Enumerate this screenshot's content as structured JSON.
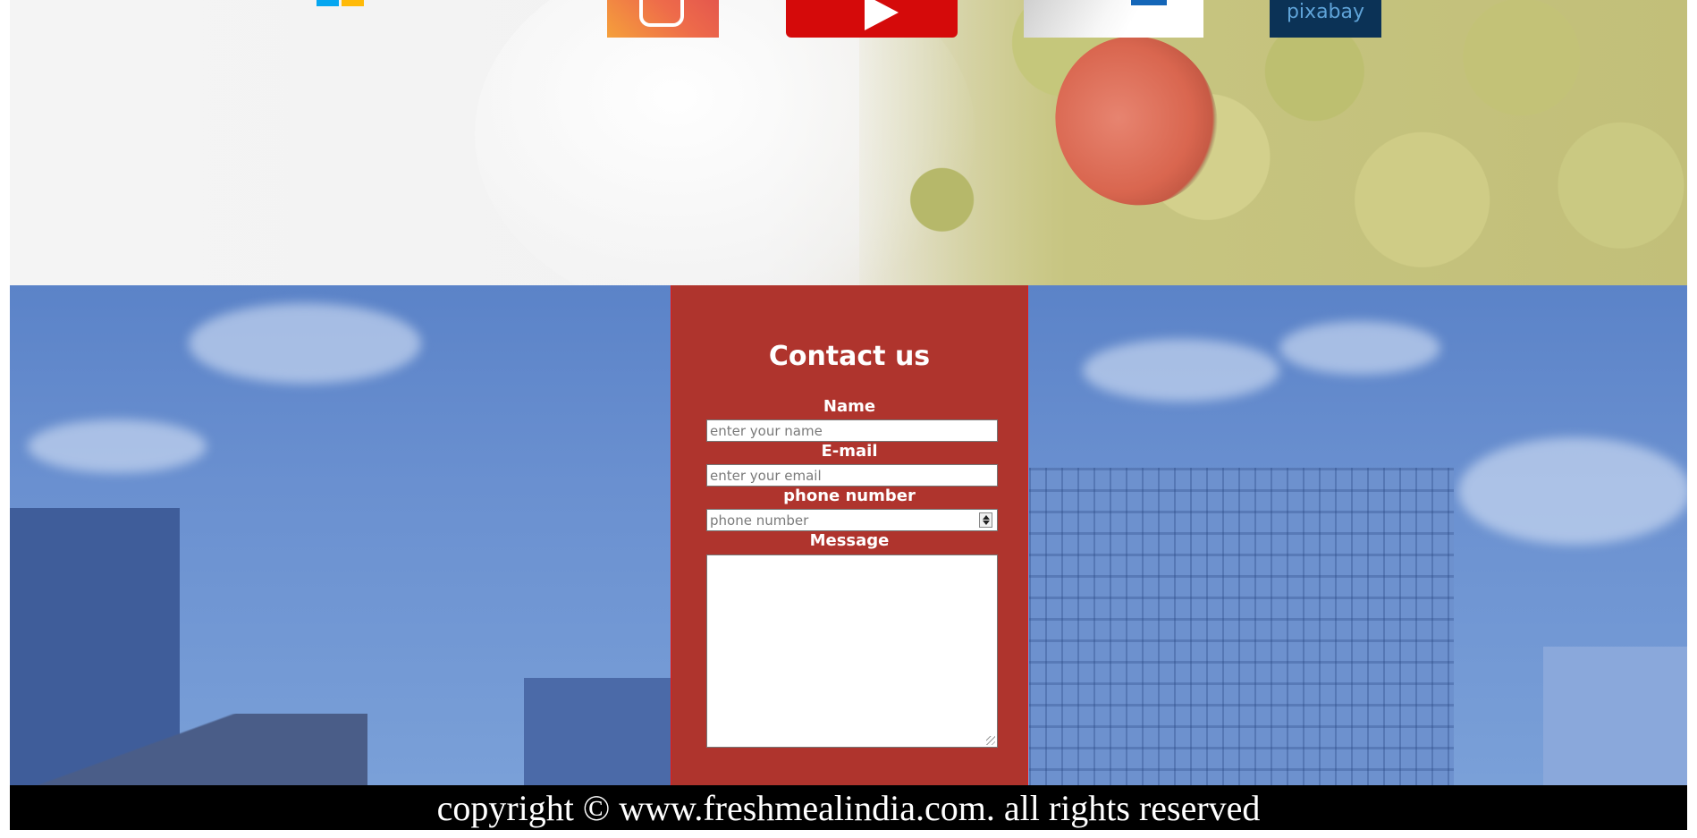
{
  "partner_logos": [
    {
      "name": "Microsoft"
    },
    {
      "name": "Instagram"
    },
    {
      "name": "YouTube"
    },
    {
      "name": "document"
    },
    {
      "name": "Pixabay",
      "label": "pixabay"
    }
  ],
  "contact": {
    "title": "Contact us",
    "fields": {
      "name": {
        "label": "Name",
        "placeholder": "enter your name",
        "value": ""
      },
      "email": {
        "label": "E-mail",
        "placeholder": "enter your email",
        "value": ""
      },
      "phone": {
        "label": "phone number",
        "placeholder": "phone number",
        "value": ""
      },
      "message": {
        "label": "Message",
        "value": ""
      }
    }
  },
  "footer": {
    "copyright": "copyright © www.freshmealindia.com. all rights reserved"
  },
  "colors": {
    "contact_panel": "#af342d",
    "footer": "#000000",
    "sky": "#6a90d0"
  }
}
